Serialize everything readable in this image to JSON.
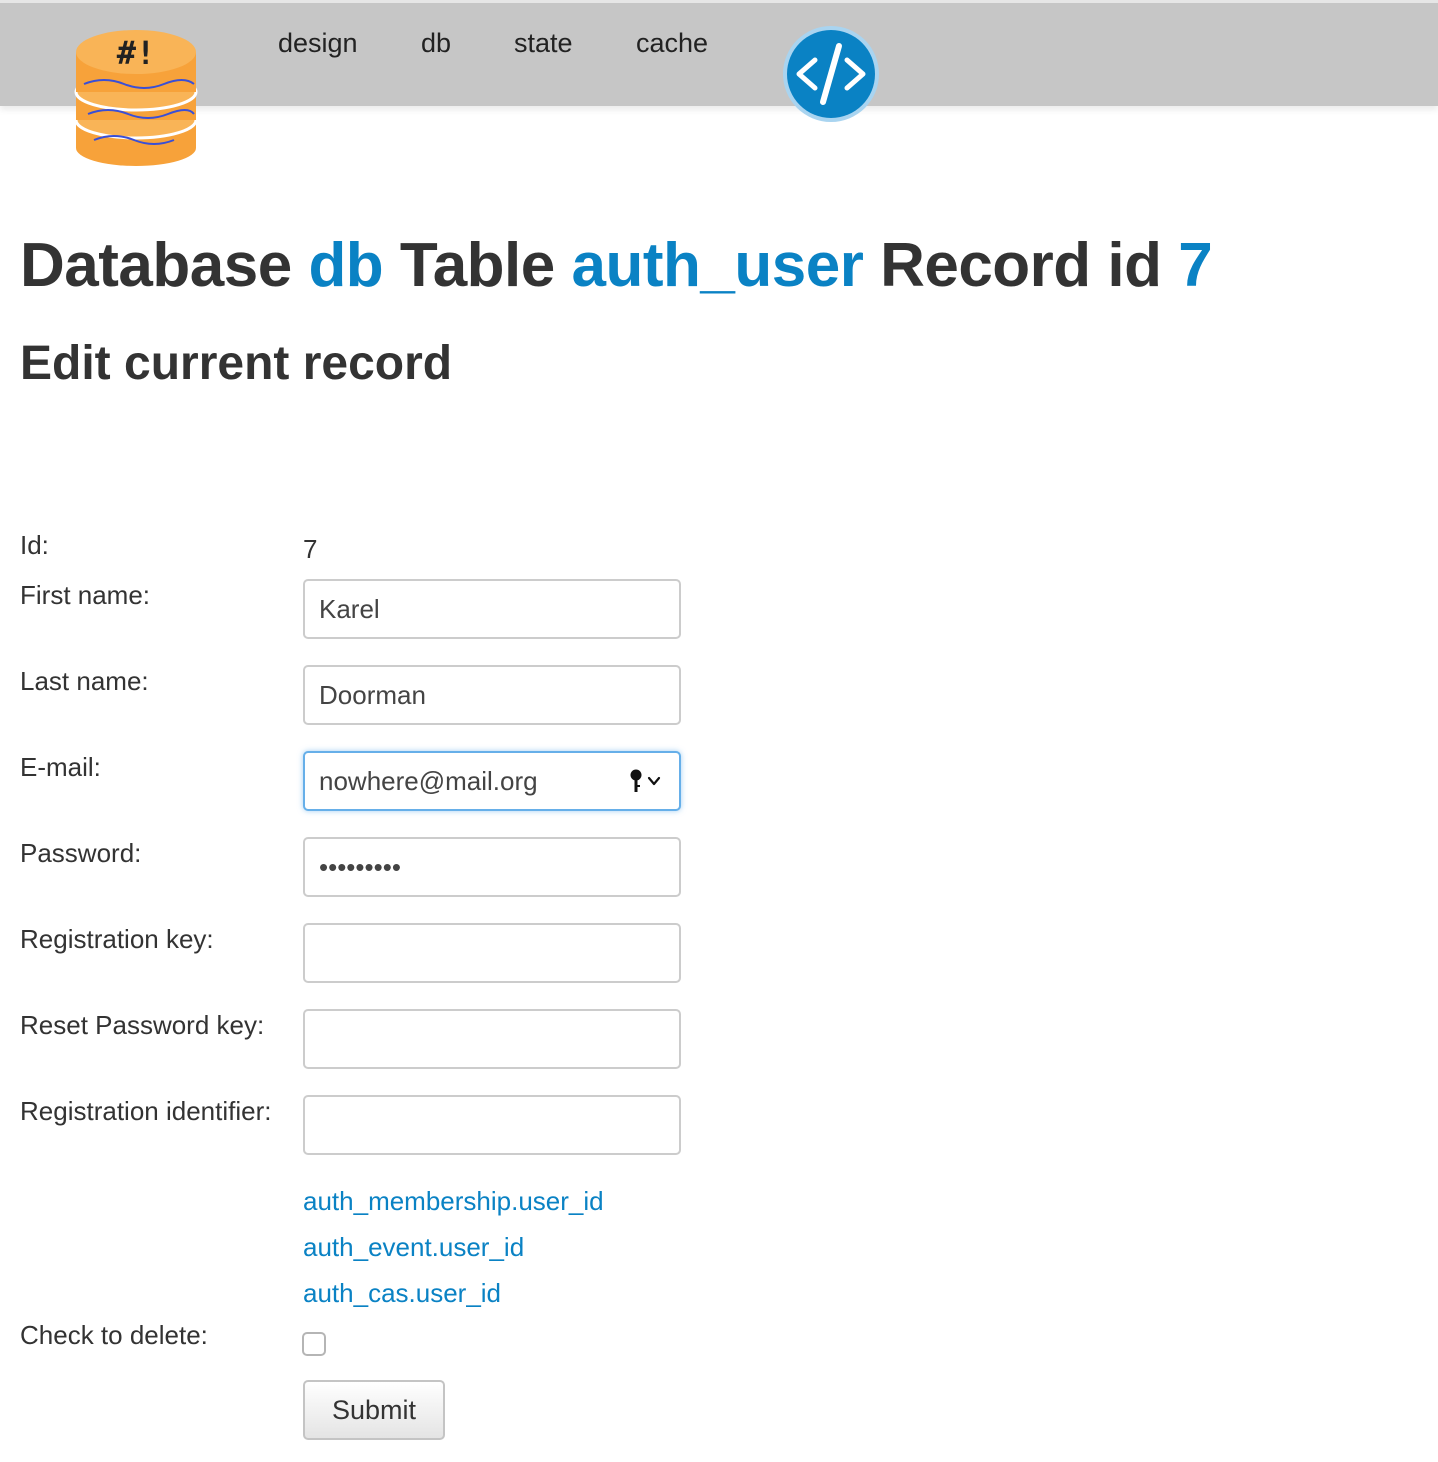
{
  "nav": {
    "items": [
      {
        "label": "design"
      },
      {
        "label": "db"
      },
      {
        "label": "state"
      },
      {
        "label": "cache"
      }
    ]
  },
  "logo": {
    "icon": "database-stack-icon",
    "text": "#!",
    "color": "#f7a23a"
  },
  "badge": {
    "icon": "code-tag-icon",
    "text": "</>",
    "color": "#0a82c4"
  },
  "title": {
    "database_word": "Database",
    "database_name": "db",
    "table_word": "Table",
    "table_name": "auth_user",
    "record_word": "Record id",
    "record_id": "7"
  },
  "subtitle": "Edit current record",
  "form": {
    "id_label": "Id:",
    "id_value": "7",
    "first_name_label": "First name:",
    "first_name_value": "Karel",
    "last_name_label": "Last name:",
    "last_name_value": "Doorman",
    "email_label": "E-mail:",
    "email_value": "nowhere@mail.org",
    "password_label": "Password:",
    "password_value": "•••••••••",
    "registration_key_label": "Registration key:",
    "registration_key_value": "",
    "reset_password_key_label": "Reset Password key:",
    "reset_password_key_value": "",
    "registration_identifier_label": "Registration identifier:",
    "registration_identifier_value": "",
    "references": [
      "auth_membership.user_id",
      "auth_event.user_id",
      "auth_cas.user_id"
    ],
    "delete_label": "Check to delete:",
    "submit_label": "Submit"
  },
  "colors": {
    "link": "#0a82c4",
    "topbar": "#c6c6c6",
    "focus": "#66afe9"
  }
}
